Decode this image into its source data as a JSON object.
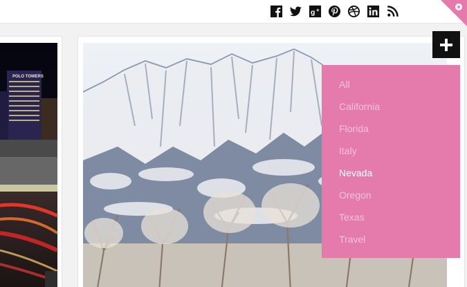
{
  "header": {
    "social_icons": [
      "facebook-icon",
      "twitter-icon",
      "google-plus-icon",
      "pinterest-icon",
      "dribbble-icon",
      "linkedin-icon",
      "rss-icon"
    ],
    "corner_icon": "plus-circle-icon"
  },
  "colors": {
    "accent_pink": "#e57aad",
    "menu_inactive_text": "#f7c2da",
    "menu_active_text": "#ffffff",
    "toggle_button_bg": "#111111"
  },
  "filter_menu": {
    "toggle_icon": "plus-icon",
    "items": [
      {
        "label": "All",
        "active": false
      },
      {
        "label": "California",
        "active": false
      },
      {
        "label": "Florida",
        "active": false
      },
      {
        "label": "Italy",
        "active": false
      },
      {
        "label": "Nevada",
        "active": true
      },
      {
        "label": "Oregon",
        "active": false
      },
      {
        "label": "Texas",
        "active": false
      },
      {
        "label": "Travel",
        "active": false
      }
    ]
  },
  "gallery": {
    "left_photo_sign": "POLO TOWERS"
  }
}
